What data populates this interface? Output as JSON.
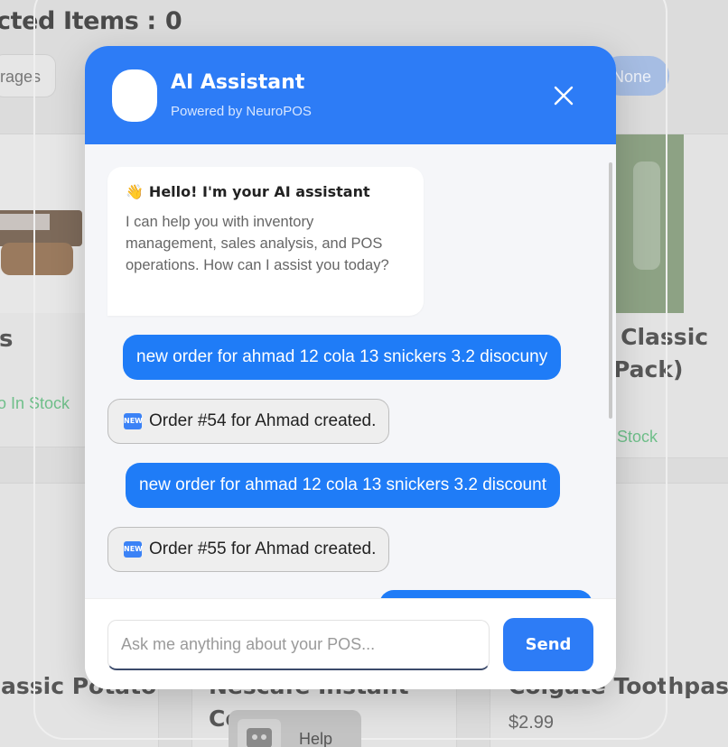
{
  "background": {
    "selected_items_label": "cted Items :",
    "selected_items_count": "0",
    "category_chip_left": "rages",
    "category_chip_right": "None",
    "cards": {
      "card1_name": "s",
      "card1_stock": "o In Stock",
      "card2_name_line1": "la Classic",
      "card2_name_line2": "Pack)",
      "card2_stock": "Stock",
      "card3_name": "assic Potato",
      "card4_name_line1": "Nescafe Instant",
      "card4_name_line2": "Co",
      "card5_name": "Colgate Toothpaste",
      "card5_price": "$2.99"
    },
    "help_label": "Help"
  },
  "assistant": {
    "title": "AI Assistant",
    "subtitle": "Powered by NeuroPOS",
    "welcome": {
      "emoji": "👋",
      "title": "Hello! I'm your AI assistant",
      "body": "I can help you with inventory management, sales analysis, and POS operations. How can I assist you today?"
    },
    "messages": [
      {
        "role": "user",
        "text": "new order for ahmad 12 cola 13 snickers 3.2 disocuny"
      },
      {
        "role": "bot",
        "icon": "new-icon",
        "text": "Order #54 for Ahmad created."
      },
      {
        "role": "user",
        "text": "new order for ahmad 12 cola 13 snickers 3.2 discount"
      },
      {
        "role": "bot",
        "icon": "new-icon",
        "text": "Order #55 for Ahmad created."
      }
    ],
    "new_badge": "NEW",
    "input": {
      "placeholder": "Ask me anything about your POS...",
      "value": ""
    },
    "send_label": "Send"
  },
  "colors": {
    "primary": "#2d7cf6",
    "user_bubble": "#1f7cf7",
    "bot_bubble": "#eeeeee",
    "chat_bg": "#f5f6f9",
    "in_stock": "#6fbf8a"
  }
}
